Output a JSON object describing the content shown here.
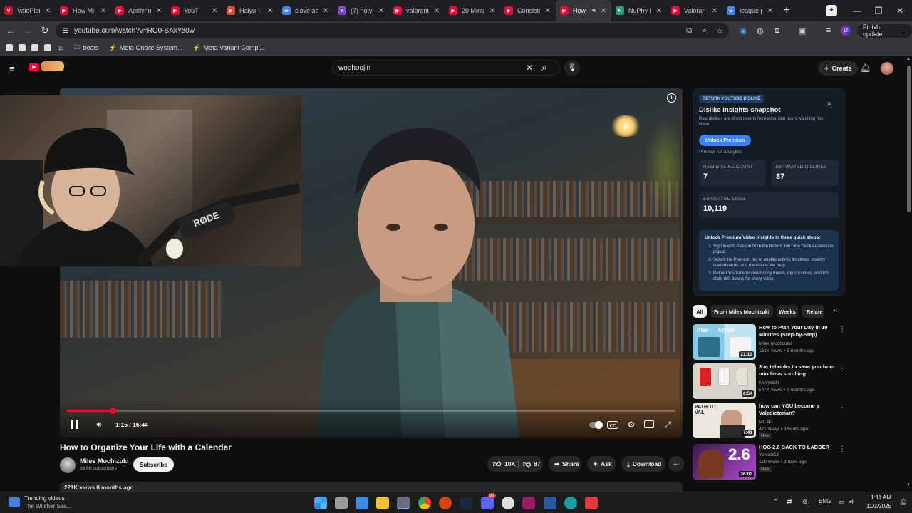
{
  "browser": {
    "tabs": [
      {
        "title": "ValoPlan",
        "fav_color": "#c4132a",
        "fav_char": "V"
      },
      {
        "title": "How Mi",
        "fav_color": "#ff0033",
        "fav_char": "▶"
      },
      {
        "title": "Aprilynn",
        "fav_color": "#ff0033",
        "fav_char": "▶"
      },
      {
        "title": "YouT",
        "fav_color": "#ff0033",
        "fav_char": "▶"
      },
      {
        "title": "Haiyu ♡",
        "fav_color": "#e84a3a",
        "fav_char": "▶"
      },
      {
        "title": "clove ab",
        "fav_color": "#4285f4",
        "fav_char": "G"
      },
      {
        "title": "(7) notyc",
        "fav_color": "#7b4bd6",
        "fav_char": "n"
      },
      {
        "title": "valorant",
        "fav_color": "#ff0033",
        "fav_char": "▶"
      },
      {
        "title": "20 Minu",
        "fav_color": "#ff0033",
        "fav_char": "▶"
      },
      {
        "title": "Consiste",
        "fav_color": "#ff0033",
        "fav_char": "▶"
      },
      {
        "title": "How",
        "fav_color": "#ff0033",
        "fav_char": "▶",
        "active": true
      },
      {
        "title": "NuPhy I",
        "fav_color": "#1aa57a",
        "fav_char": "N"
      },
      {
        "title": "Valoran",
        "fav_color": "#ff0033",
        "fav_char": "▶"
      },
      {
        "title": "league p",
        "fav_color": "#4285f4",
        "fav_char": "G"
      }
    ],
    "url": "youtube.com/watch?v=RO0-SAkYe0w",
    "finish_update_label": "Finish update",
    "profile_initial": "D",
    "bookmarks": [
      {
        "label": "beats",
        "icon": "folder-icon"
      },
      {
        "label": "Meta Onsite System...",
        "icon": "bookmark-icon"
      },
      {
        "label": "Meta Variant Compi...",
        "icon": "bookmark-icon"
      }
    ]
  },
  "youtube": {
    "search_value": "woohoojin",
    "create_label": "Create",
    "player": {
      "time": "1:15 / 16:44",
      "progress": 0.075
    },
    "video_title": "How to Organize Your Life with a Calendar",
    "channel_name": "Miles Mochizuki",
    "subscribers": "93.8K subscribers",
    "subscribe_label": "Subscribe",
    "likes": "10K",
    "dislikes": "87",
    "share_label": "Share",
    "ask_label": "Ask",
    "download_label": "Download",
    "desc_preview": "221K views  8 months ago"
  },
  "dislike_panel": {
    "tag": "RETURN YOUTUBE DISLIKE",
    "title": "Dislike insights snapshot",
    "subtitle": "Raw dislikes are direct reports from extension users watching this video.",
    "unlock_label": "Unlock Premium",
    "preview_label": "Preview full analytics",
    "raw_label": "RAW DISLIKE COUNT",
    "raw_value": "7",
    "est_dislikes_label": "ESTIMATED DISLIKES",
    "est_dislikes_value": "87",
    "est_likes_label": "ESTIMATED LIKES",
    "est_likes_value": "10,119",
    "premium_heading": "Unlock Premium Video Insights in three quick steps:",
    "steps": [
      "Sign in with Patreon from the Return YouTube Dislike extension popup.",
      "Select the Premium tier to enable activity timelines, country leaderboards, and the interactive map.",
      "Reload YouTube to view hourly trends, top countries, and US state drill-downs for every video."
    ]
  },
  "chips": [
    "All",
    "From Miles Mochizuki",
    "Weeks",
    "Relate"
  ],
  "recommendations": [
    {
      "title": "How to Plan Your Day in 10 Minutes (Step-by-Step)",
      "channel": "Miles Mochizuki",
      "meta": "151K views • 3 months ago",
      "duration": "21:13",
      "thumb_text": "Plan → Action",
      "thumb_color": "#7fc6e0",
      "badge": ""
    },
    {
      "title": "3 notebooks to save you from mindless scrolling",
      "channel": "henrydidit",
      "meta": "547K views • 9 months ago",
      "duration": "8:54",
      "thumb_text": "",
      "thumb_color": "#d9d6d0",
      "badge": ""
    },
    {
      "title": "how can YOU become a Valedictorian?",
      "channel": "Mr. AP",
      "meta": "471 views • 8 hours ago",
      "duration": "7:41",
      "thumb_text": "PATH TO VAL",
      "thumb_color": "#e8e4dc",
      "badge": "New"
    },
    {
      "title": "HOG 2.6 BACK TO LADDER",
      "channel": "YersonCz",
      "meta": "11K views • 3 days ago",
      "duration": "36:02",
      "thumb_text": "2.6",
      "thumb_color": "#6a2f8c",
      "badge": "New"
    }
  ],
  "taskbar": {
    "widget_title": "Trending videos",
    "widget_sub": "The Witcher Sea...",
    "lang": "ENG",
    "time": "1:11 AM",
    "date": "11/3/2025",
    "discord_badge": "99"
  }
}
